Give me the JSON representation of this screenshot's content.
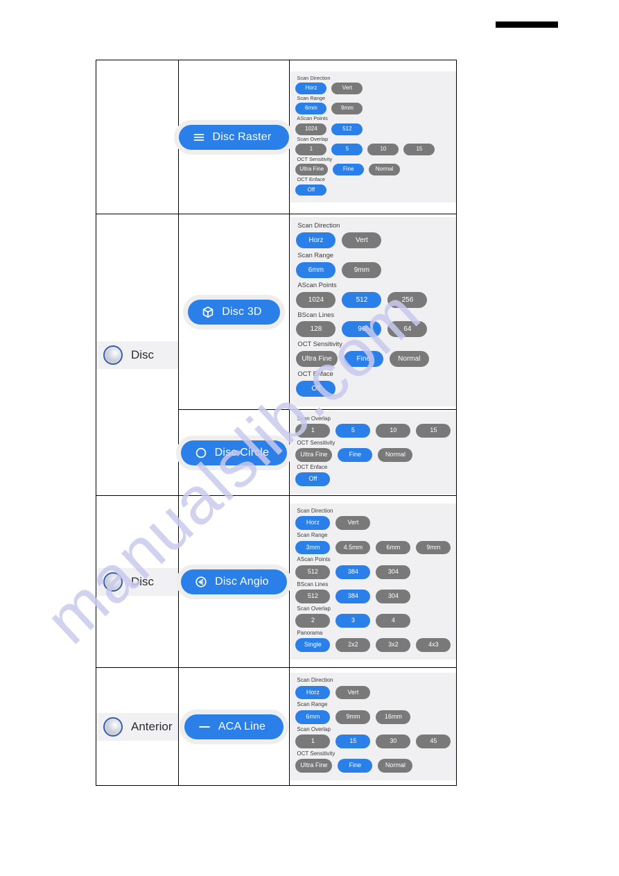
{
  "document": {
    "redaction_bar": true,
    "watermark": "manualslib.com"
  },
  "table": {
    "rows": [
      {
        "category": null,
        "scan_button": {
          "label": "Disc Raster",
          "icon": "lines-icon"
        },
        "panel_size": "small",
        "settings": [
          {
            "label": "Scan Direction",
            "options": [
              {
                "text": "Horz",
                "selected": true
              },
              {
                "text": "Vert",
                "selected": false
              }
            ]
          },
          {
            "label": "Scan Range",
            "options": [
              {
                "text": "6mm",
                "selected": true
              },
              {
                "text": "9mm",
                "selected": false
              }
            ]
          },
          {
            "label": "AScan Points",
            "options": [
              {
                "text": "1024",
                "selected": false
              },
              {
                "text": "512",
                "selected": true
              }
            ]
          },
          {
            "label": "Scan Overlap",
            "options": [
              {
                "text": "1",
                "selected": false
              },
              {
                "text": "5",
                "selected": true
              },
              {
                "text": "10",
                "selected": false
              },
              {
                "text": "15",
                "selected": false
              }
            ]
          },
          {
            "label": "OCT Sensitivity",
            "options": [
              {
                "text": "Ultra Fine",
                "selected": false
              },
              {
                "text": "Fine",
                "selected": true
              },
              {
                "text": "Normal",
                "selected": false
              }
            ]
          },
          {
            "label": "OCT Enface",
            "options": [
              {
                "text": "Off",
                "selected": true
              }
            ]
          }
        ]
      },
      {
        "category": {
          "label": "Disc",
          "icon": "eye-lens-icon"
        },
        "scan_button": {
          "label": "Disc 3D",
          "icon": "cube-icon"
        },
        "panel_size": "big",
        "settings": [
          {
            "label": "Scan Direction",
            "options": [
              {
                "text": "Horz",
                "selected": true
              },
              {
                "text": "Vert",
                "selected": false
              }
            ]
          },
          {
            "label": "Scan Range",
            "options": [
              {
                "text": "6mm",
                "selected": true
              },
              {
                "text": "9mm",
                "selected": false
              }
            ]
          },
          {
            "label": "AScan Points",
            "options": [
              {
                "text": "1024",
                "selected": false
              },
              {
                "text": "512",
                "selected": true
              },
              {
                "text": "256",
                "selected": false
              }
            ]
          },
          {
            "label": "BScan Lines",
            "options": [
              {
                "text": "128",
                "selected": false
              },
              {
                "text": "96",
                "selected": true
              },
              {
                "text": "64",
                "selected": false
              }
            ]
          },
          {
            "label": "OCT Sensitivity",
            "options": [
              {
                "text": "Ultra Fine",
                "selected": false
              },
              {
                "text": "Fine",
                "selected": true
              },
              {
                "text": "Normal",
                "selected": false
              }
            ]
          },
          {
            "label": "OCT Enface",
            "options": [
              {
                "text": "Off",
                "selected": true
              }
            ]
          }
        ]
      },
      {
        "category": null,
        "scan_button": {
          "label": "Disc Circle",
          "icon": "circle-icon"
        },
        "panel_size": "med",
        "settings": [
          {
            "label": "Scan Overlap",
            "options": [
              {
                "text": "1",
                "selected": false
              },
              {
                "text": "5",
                "selected": true
              },
              {
                "text": "10",
                "selected": false
              },
              {
                "text": "15",
                "selected": false
              }
            ]
          },
          {
            "label": "OCT Sensitivity",
            "options": [
              {
                "text": "Ultra Fine",
                "selected": false
              },
              {
                "text": "Fine",
                "selected": true
              },
              {
                "text": "Normal",
                "selected": false
              }
            ]
          },
          {
            "label": "OCT Enface",
            "options": [
              {
                "text": "Off",
                "selected": true
              }
            ]
          }
        ]
      },
      {
        "category": {
          "label": "Disc",
          "icon": "eye-lens-icon"
        },
        "scan_button": {
          "label": "Disc Angio",
          "icon": "circle-arrow-left-icon"
        },
        "panel_size": "med",
        "settings": [
          {
            "label": "Scan Direction",
            "options": [
              {
                "text": "Horz",
                "selected": true
              },
              {
                "text": "Vert",
                "selected": false
              }
            ]
          },
          {
            "label": "Scan Range",
            "options": [
              {
                "text": "3mm",
                "selected": true
              },
              {
                "text": "4.5mm",
                "selected": false
              },
              {
                "text": "6mm",
                "selected": false
              },
              {
                "text": "9mm",
                "selected": false
              }
            ]
          },
          {
            "label": "AScan Points",
            "options": [
              {
                "text": "512",
                "selected": false
              },
              {
                "text": "384",
                "selected": true
              },
              {
                "text": "304",
                "selected": false
              }
            ]
          },
          {
            "label": "BScan Lines",
            "options": [
              {
                "text": "512",
                "selected": false
              },
              {
                "text": "384",
                "selected": true
              },
              {
                "text": "304",
                "selected": false
              }
            ]
          },
          {
            "label": "Scan Overlap",
            "options": [
              {
                "text": "2",
                "selected": false
              },
              {
                "text": "3",
                "selected": true
              },
              {
                "text": "4",
                "selected": false
              }
            ]
          },
          {
            "label": "Panorama",
            "options": [
              {
                "text": "Single",
                "selected": true
              },
              {
                "text": "2x2",
                "selected": false
              },
              {
                "text": "3x2",
                "selected": false
              },
              {
                "text": "4x3",
                "selected": false
              }
            ]
          }
        ]
      },
      {
        "category": {
          "label": "Anterior",
          "icon": "eye-lens-icon"
        },
        "scan_button": {
          "label": "ACA Line",
          "icon": "line-icon"
        },
        "panel_size": "med",
        "settings": [
          {
            "label": "Scan Direction",
            "options": [
              {
                "text": "Horz",
                "selected": true
              },
              {
                "text": "Vert",
                "selected": false
              }
            ]
          },
          {
            "label": "Scan Range",
            "options": [
              {
                "text": "6mm",
                "selected": true
              },
              {
                "text": "9mm",
                "selected": false
              },
              {
                "text": "16mm",
                "selected": false
              }
            ]
          },
          {
            "label": "Scan Overlap",
            "options": [
              {
                "text": "1",
                "selected": false
              },
              {
                "text": "15",
                "selected": true
              },
              {
                "text": "30",
                "selected": false
              },
              {
                "text": "45",
                "selected": false
              }
            ]
          },
          {
            "label": "OCT Sensitivity",
            "options": [
              {
                "text": "Ultra Fine",
                "selected": false
              },
              {
                "text": "Fine",
                "selected": true
              },
              {
                "text": "Normal",
                "selected": false
              }
            ]
          }
        ]
      }
    ]
  },
  "colors": {
    "accent_blue": "#2a7fe8",
    "pill_gray": "#797979",
    "panel_bg": "#f0f0f2",
    "category_bg": "#f1f1f3",
    "watermark": "#c9c9ee"
  }
}
